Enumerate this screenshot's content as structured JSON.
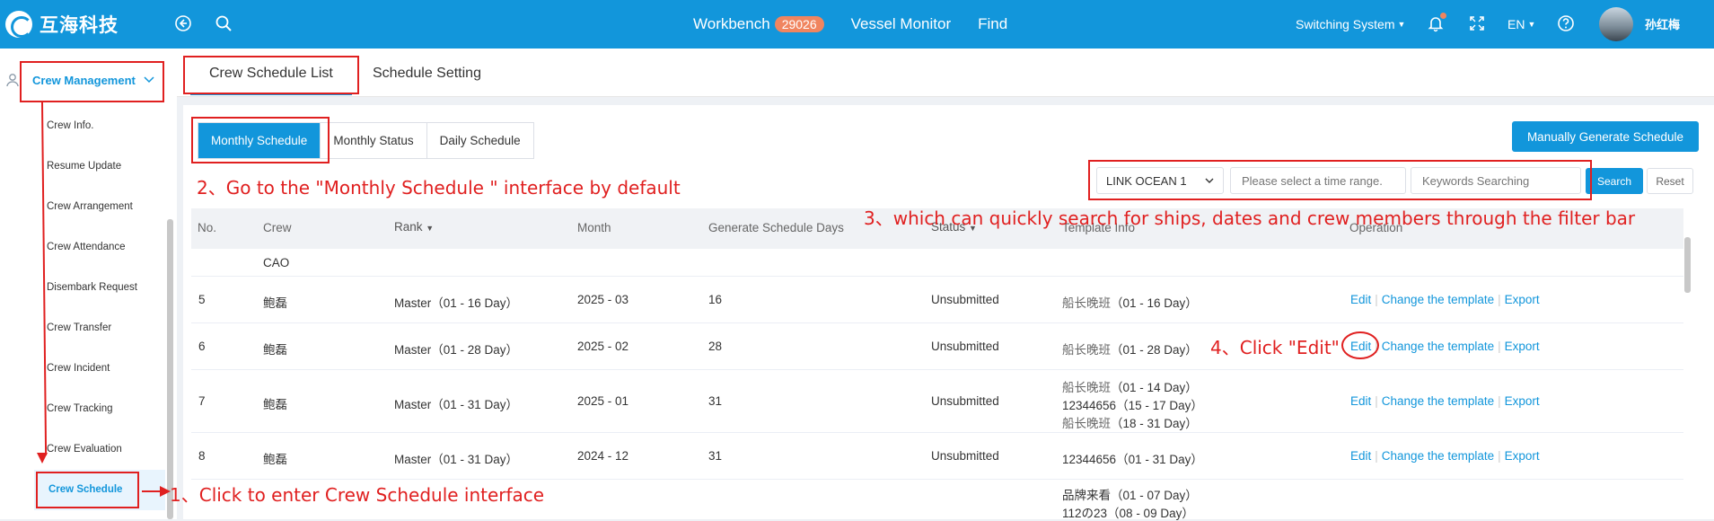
{
  "topbar": {
    "logo_text": "互海科技",
    "nav": [
      {
        "label": "Workbench",
        "badge": "29026"
      },
      {
        "label": "Vessel Monitor"
      },
      {
        "label": "Find"
      }
    ],
    "switching_system": "Switching System",
    "language": "EN",
    "username": "孙红梅"
  },
  "sidebar": {
    "section": "Crew Management",
    "items": [
      "Crew Info.",
      "Resume Update",
      "Crew Arrangement",
      "Crew Attendance",
      "Disembark Request",
      "Crew Transfer",
      "Crew Incident",
      "Crew Tracking",
      "Crew Evaluation",
      "Crew Schedule"
    ]
  },
  "tabs": {
    "list": "Crew Schedule List",
    "setting": "Schedule Setting"
  },
  "subtabs": [
    "Monthly Schedule",
    "Monthly Status",
    "Daily Schedule"
  ],
  "buttons": {
    "generate": "Manually Generate Schedule",
    "search": "Search",
    "reset": "Reset"
  },
  "filters": {
    "vessel": "LINK OCEAN 1",
    "time_placeholder": "Please select a time range.",
    "keyword_placeholder": "Keywords Searching"
  },
  "table": {
    "headers": [
      "No.",
      "Crew",
      "Rank",
      "Month",
      "Generate Schedule Days",
      "Status",
      "Template Info",
      "Operation"
    ],
    "partial_row": {
      "crew": "CAO"
    },
    "rows": [
      {
        "no": "5",
        "crew": "鲍磊",
        "rank": "Master（01 - 16 Day）",
        "month": "2025 - 03",
        "days": "16",
        "status": "Unsubmitted",
        "templates": [
          {
            "name": "船长晚班",
            "range": "（01 - 16 Day）"
          }
        ]
      },
      {
        "no": "6",
        "crew": "鲍磊",
        "rank": "Master（01 - 28 Day）",
        "month": "2025 - 02",
        "days": "28",
        "status": "Unsubmitted",
        "templates": [
          {
            "name": "船长晚班",
            "range": "（01 - 28 Day）"
          }
        ]
      },
      {
        "no": "7",
        "crew": "鲍磊",
        "rank": "Master（01 - 31 Day）",
        "month": "2025 - 01",
        "days": "31",
        "status": "Unsubmitted",
        "templates": [
          {
            "name": "船长晚班",
            "range": "（01 - 14 Day）"
          },
          {
            "name": "12344656",
            "range": "（15 - 17 Day）"
          },
          {
            "name": "船长晚班",
            "range": "（18 - 31 Day）"
          }
        ]
      },
      {
        "no": "8",
        "crew": "鲍磊",
        "rank": "Master（01 - 31 Day）",
        "month": "2024 - 12",
        "days": "31",
        "status": "Unsubmitted",
        "templates": [
          {
            "name": "12344656",
            "range": "（01 - 31 Day）"
          }
        ]
      }
    ],
    "next_row_templates": [
      {
        "name": "品牌来看",
        "range": "（01 - 07 Day）"
      },
      {
        "name": "112の23",
        "range": "（08 - 09 Day）"
      }
    ],
    "ops": {
      "edit": "Edit",
      "change": "Change the template",
      "export": "Export"
    }
  },
  "annotations": {
    "a1": "1、Click to enter Crew Schedule interface",
    "a2": "2、Go to the \"Monthly Schedule \" interface  by default",
    "a3": "3、which can quickly search for ships, dates and crew members through the filter bar",
    "a4": "4、Click \"Edit\""
  },
  "colors": {
    "primary": "#1296db",
    "annotation": "#e02020",
    "badge": "#f0855f"
  }
}
